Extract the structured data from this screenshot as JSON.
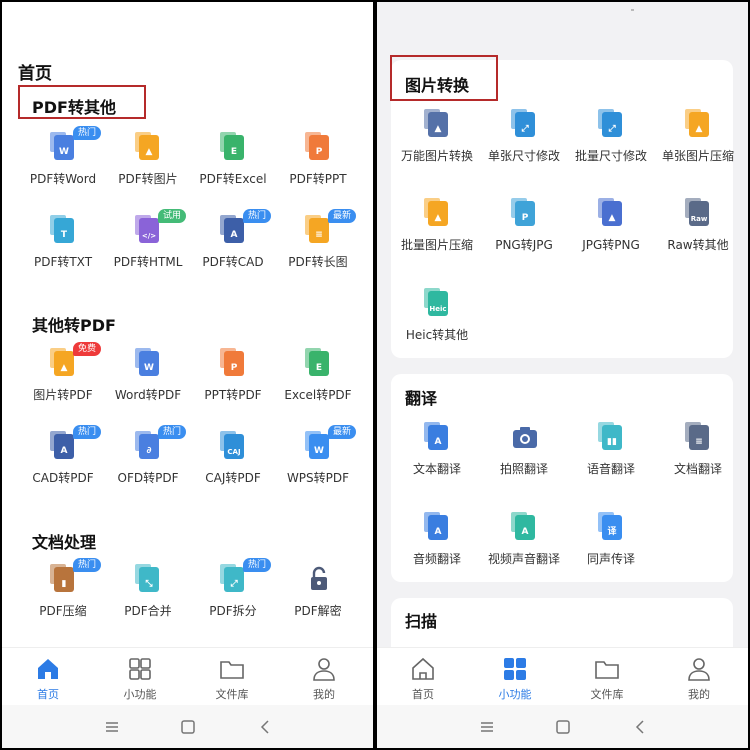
{
  "left": {
    "page_title": "首页",
    "sections": [
      {
        "title": "PDF转其他",
        "tools": [
          {
            "label": "PDF转Word",
            "icon": "pdf-to-word-icon",
            "badge": "热门",
            "badge_color": "blue"
          },
          {
            "label": "PDF转图片",
            "icon": "pdf-to-image-icon"
          },
          {
            "label": "PDF转Excel",
            "icon": "pdf-to-excel-icon"
          },
          {
            "label": "PDF转PPT",
            "icon": "pdf-to-ppt-icon"
          },
          {
            "label": "PDF转TXT",
            "icon": "pdf-to-txt-icon"
          },
          {
            "label": "PDF转HTML",
            "icon": "pdf-to-html-icon",
            "badge": "试用",
            "badge_color": "green"
          },
          {
            "label": "PDF转CAD",
            "icon": "pdf-to-cad-icon",
            "badge": "热门",
            "badge_color": "blue"
          },
          {
            "label": "PDF转长图",
            "icon": "pdf-to-long-image-icon",
            "badge": "最新",
            "badge_color": "blue"
          }
        ]
      },
      {
        "title": "其他转PDF",
        "tools": [
          {
            "label": "图片转PDF",
            "icon": "image-to-pdf-icon",
            "badge": "免费",
            "badge_color": "red"
          },
          {
            "label": "Word转PDF",
            "icon": "word-to-pdf-icon"
          },
          {
            "label": "PPT转PDF",
            "icon": "ppt-to-pdf-icon"
          },
          {
            "label": "Excel转PDF",
            "icon": "excel-to-pdf-icon"
          },
          {
            "label": "CAD转PDF",
            "icon": "cad-to-pdf-icon",
            "badge": "热门",
            "badge_color": "blue"
          },
          {
            "label": "OFD转PDF",
            "icon": "ofd-to-pdf-icon",
            "badge": "热门",
            "badge_color": "blue"
          },
          {
            "label": "CAJ转PDF",
            "icon": "caj-to-pdf-icon"
          },
          {
            "label": "WPS转PDF",
            "icon": "wps-to-pdf-icon",
            "badge": "最新",
            "badge_color": "blue"
          }
        ]
      },
      {
        "title": "文档处理",
        "tools": [
          {
            "label": "PDF压缩",
            "icon": "pdf-compress-icon",
            "badge": "热门",
            "badge_color": "blue"
          },
          {
            "label": "PDF合并",
            "icon": "pdf-merge-icon"
          },
          {
            "label": "PDF拆分",
            "icon": "pdf-split-icon",
            "badge": "热门",
            "badge_color": "blue"
          },
          {
            "label": "PDF解密",
            "icon": "pdf-unlock-icon"
          }
        ]
      }
    ]
  },
  "right": {
    "sections": [
      {
        "title": "图片转换",
        "tools": [
          {
            "label": "万能图片转换",
            "icon": "image-convert-icon"
          },
          {
            "label": "单张尺寸修改",
            "icon": "resize-single-icon"
          },
          {
            "label": "批量尺寸修改",
            "icon": "resize-batch-icon"
          },
          {
            "label": "单张图片压缩",
            "icon": "compress-single-icon"
          },
          {
            "label": "批量图片压缩",
            "icon": "compress-batch-icon"
          },
          {
            "label": "PNG转JPG",
            "icon": "png-to-jpg-icon"
          },
          {
            "label": "JPG转PNG",
            "icon": "jpg-to-png-icon"
          },
          {
            "label": "Raw转其他",
            "icon": "raw-convert-icon"
          },
          {
            "label": "Heic转其他",
            "icon": "heic-convert-icon"
          }
        ]
      },
      {
        "title": "翻译",
        "tools": [
          {
            "label": "文本翻译",
            "icon": "text-translate-icon"
          },
          {
            "label": "拍照翻译",
            "icon": "camera-translate-icon"
          },
          {
            "label": "语音翻译",
            "icon": "voice-translate-icon"
          },
          {
            "label": "文档翻译",
            "icon": "document-translate-icon"
          },
          {
            "label": "音频翻译",
            "icon": "audio-translate-icon"
          },
          {
            "label": "视频声音翻译",
            "icon": "video-translate-icon"
          },
          {
            "label": "同声传译",
            "icon": "simultaneous-interpret-icon"
          }
        ]
      },
      {
        "title": "扫描"
      }
    ]
  },
  "tabs": [
    {
      "label": "首页",
      "icon": "home-icon"
    },
    {
      "label": "小功能",
      "icon": "grid-icon"
    },
    {
      "label": "文件库",
      "icon": "folder-icon"
    },
    {
      "label": "我的",
      "icon": "profile-icon"
    }
  ],
  "active_tab": {
    "left": "首页",
    "right": "小功能"
  },
  "colors": {
    "accent": "#2c7be5",
    "highlight_box": "#b52a2a",
    "badge_blue": "#3a8ef0",
    "badge_green": "#44bb77",
    "badge_red": "#ee3a3a"
  }
}
